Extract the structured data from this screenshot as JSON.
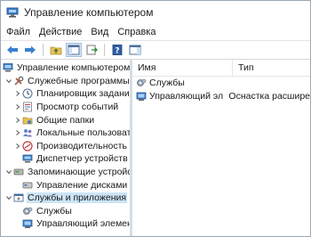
{
  "window": {
    "title": "Управление компьютером"
  },
  "menu": [
    {
      "label": "Файл"
    },
    {
      "label": "Действие"
    },
    {
      "label": "Вид"
    },
    {
      "label": "Справка"
    }
  ],
  "tree": [
    {
      "label": "Управление компьютером (л",
      "icon": "computer-icon",
      "expander": "none",
      "level": 0
    },
    {
      "label": "Служебные программы",
      "icon": "tools-icon",
      "expander": "expanded",
      "level": 1
    },
    {
      "label": "Планировщик заданий",
      "icon": "clock-icon",
      "expander": "collapsed",
      "level": 2
    },
    {
      "label": "Просмотр событий",
      "icon": "event-viewer-icon",
      "expander": "collapsed",
      "level": 2
    },
    {
      "label": "Общие папки",
      "icon": "shared-folder-icon",
      "expander": "collapsed",
      "level": 2
    },
    {
      "label": "Локальные пользовате",
      "icon": "users-icon",
      "expander": "collapsed",
      "level": 2
    },
    {
      "label": "Производительность",
      "icon": "performance-icon",
      "expander": "collapsed",
      "level": 2
    },
    {
      "label": "Диспетчер устройств",
      "icon": "device-manager-icon",
      "expander": "none",
      "level": 2
    },
    {
      "label": "Запоминающие устройст",
      "icon": "storage-icon",
      "expander": "expanded",
      "level": 1
    },
    {
      "label": "Управление дисками",
      "icon": "disk-icon",
      "expander": "none",
      "level": 2
    },
    {
      "label": "Службы и приложения",
      "icon": "services-apps-icon",
      "expander": "expanded",
      "level": 1,
      "selected": true
    },
    {
      "label": "Службы",
      "icon": "services-icon",
      "expander": "none",
      "level": 2
    },
    {
      "label": "Управляющий элемен",
      "icon": "wmi-icon",
      "expander": "none",
      "level": 2
    }
  ],
  "details": {
    "columns": {
      "name": "Имя",
      "type": "Тип"
    },
    "rows": [
      {
        "name": "Службы",
        "type": "",
        "icon": "services-icon"
      },
      {
        "name": "Управляющий элем...",
        "type": "Оснастка расшире",
        "icon": "wmi-icon"
      }
    ]
  },
  "colors": {
    "selection": "#cce4f7",
    "toolbar_active": "#dbe8f6"
  }
}
